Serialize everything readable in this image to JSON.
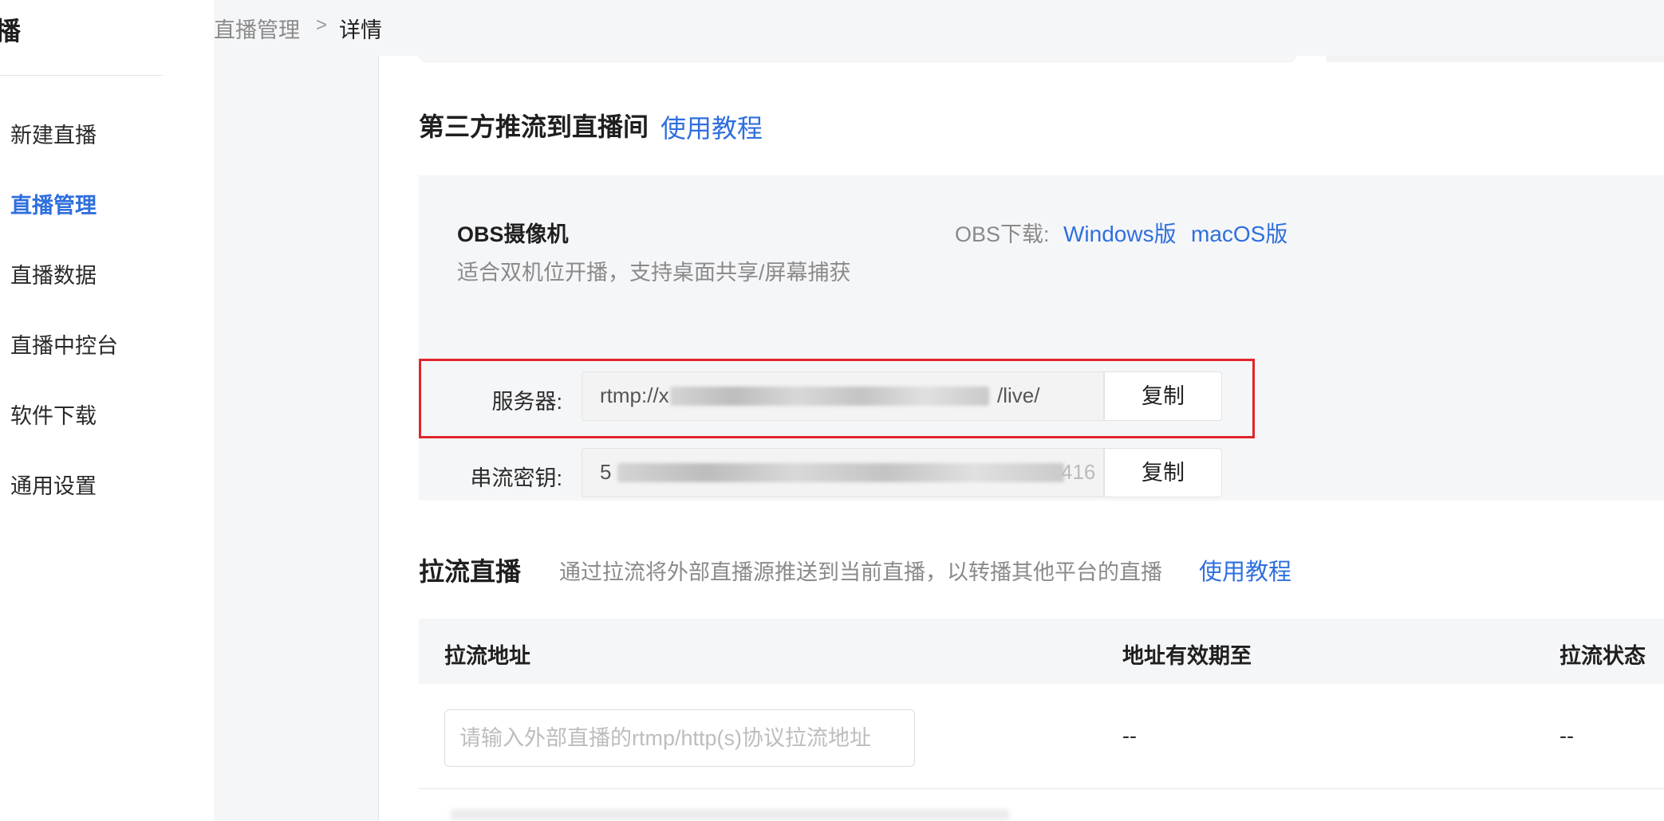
{
  "sidebar": {
    "brand": "播",
    "items": [
      {
        "label": "新建直播",
        "active": false
      },
      {
        "label": "直播管理",
        "active": true
      },
      {
        "label": "直播数据",
        "active": false
      },
      {
        "label": "直播中控台",
        "active": false
      },
      {
        "label": "软件下载",
        "active": false
      },
      {
        "label": "通用设置",
        "active": false
      }
    ]
  },
  "breadcrumb": {
    "parent": "直播管理",
    "separator": ">",
    "current": "详情"
  },
  "third_party": {
    "title": "第三方推流到直播间",
    "tutorial_link": "使用教程"
  },
  "obs": {
    "title": "OBS摄像机",
    "description": "适合双机位开播，支持桌面共享/屏幕捕获",
    "download_label": "OBS下载:",
    "download_windows": "Windows版",
    "download_macos": "macOS版",
    "server_label": "服务器:",
    "server_value": "rtmp://x",
    "server_value_tail": "/live/",
    "server_copy": "复制",
    "key_label": "串流密钥:",
    "key_value": "5",
    "key_value_tail": "416",
    "key_copy": "复制"
  },
  "pull": {
    "title": "拉流直播",
    "description": "通过拉流将外部直播源推送到当前直播，以转播其他平台的直播",
    "tutorial_link": "使用教程",
    "columns": [
      "拉流地址",
      "地址有效期至",
      "拉流状态"
    ],
    "input_placeholder": "请输入外部直播的rtmp/http(s)协议拉流地址",
    "expiry": "--",
    "status": "--"
  },
  "colors": {
    "accent": "#2f6fde",
    "highlight": "#e0262b",
    "panel_bg": "#f5f6f8"
  }
}
